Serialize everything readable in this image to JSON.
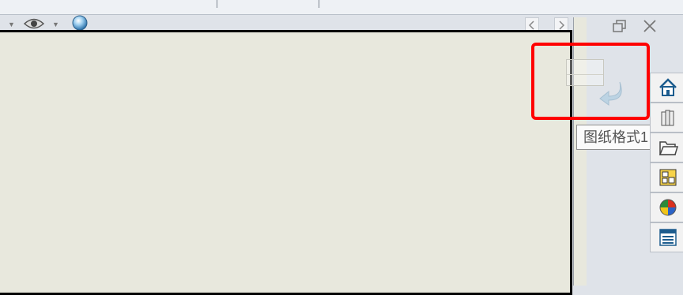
{
  "tooltip": {
    "text": "图纸格式1"
  },
  "icons": {
    "visibility": "eye-icon",
    "appearance": "globe-icon",
    "previous": "previous-sheet-icon",
    "next": "next-sheet-icon",
    "restore": "restore-window-icon",
    "close": "close-window-icon",
    "return": "return-arrow-icon"
  },
  "taskpane_tabs": [
    {
      "name": "home",
      "icon": "home-icon"
    },
    {
      "name": "design-library",
      "icon": "design-library-icon"
    },
    {
      "name": "file-explorer",
      "icon": "folder-icon"
    },
    {
      "name": "view-palette",
      "icon": "view-palette-icon"
    },
    {
      "name": "appearances",
      "icon": "appearances-icon"
    },
    {
      "name": "custom-properties",
      "icon": "custom-properties-icon"
    }
  ],
  "colors": {
    "highlight": "#ff0000",
    "sheet_background": "#e8e8dd",
    "sheet_border": "#000000"
  }
}
